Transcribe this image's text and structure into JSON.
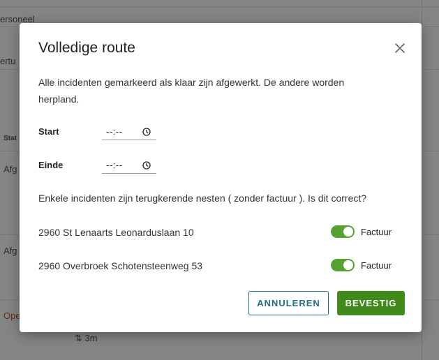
{
  "background": {
    "row1": "ersoneel",
    "row2": "ertu",
    "col_header": "Stat",
    "cell1": "Afg",
    "cell2": "Afg",
    "cell3": "Ope",
    "footer_icon": "sort-arrows-icon",
    "footer_text": "3m"
  },
  "modal": {
    "title": "Volledige route",
    "description": "Alle incidenten gemarkeerd als klaar zijn afgewerkt. De andere worden herpland.",
    "start_label": "Start",
    "start_value": "--:--",
    "end_label": "Einde",
    "end_value": "--:--",
    "question": "Enkele incidenten zijn terugkerende nesten ( zonder factuur ). Is dit correct?",
    "items": [
      {
        "address": "2960 St Lenaarts Leonarduslaan 10",
        "toggle_label": "Factuur",
        "toggle_on": true
      },
      {
        "address": "2960 Overbroek Schotensteenweg 53",
        "toggle_label": "Factuur",
        "toggle_on": true
      }
    ],
    "cancel_label": "ANNULEREN",
    "confirm_label": "BEVESTIG"
  },
  "colors": {
    "primary_green": "#3f8a1a",
    "toggle_green": "#56a131",
    "outline_blue": "#1f6e8c"
  }
}
